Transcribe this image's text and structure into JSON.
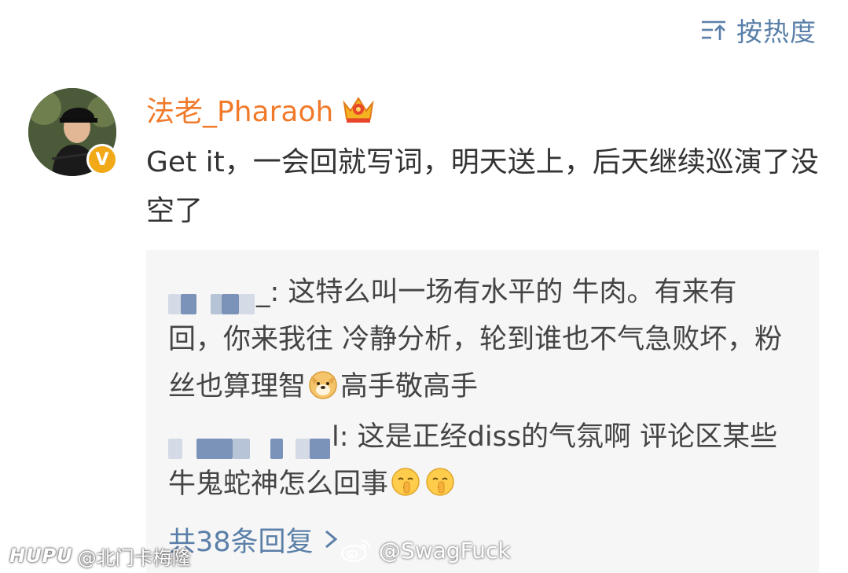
{
  "sort": {
    "label": "按热度",
    "icon": "sort-icon",
    "color": "#5a7fa8"
  },
  "comment": {
    "avatar_icon": "user-avatar",
    "badge_icon": "vip-v-badge",
    "username": "法老_Pharaoh",
    "username_color": "#f07a2a",
    "member_icon": "crown-icon",
    "text": "Get it，一会回就写词，明天送上，后天继续巡演了没空了"
  },
  "replies": {
    "items": [
      {
        "author_visible": "_",
        "author_blurred": true,
        "text_1": ": 这特么叫一场有水平的 牛肉。有来有回，你来我往 冷静分析，轮到谁也不气急败坏，粉丝也算理智",
        "emoji": "doge-emoji",
        "text_2": "高手敬高手"
      },
      {
        "author_visible": "",
        "author_blurred": true,
        "text_1": "l: 这是正经diss的气氛啊  评论区某些牛鬼蛇神怎么回事",
        "emojis": [
          "shush-emoji",
          "shush-emoji"
        ]
      }
    ],
    "more_label": "共38条回复",
    "more_icon": "chevron-right-icon"
  },
  "watermarks": {
    "left_logo": "HUPU",
    "left_text": "@北门卡梅隆",
    "right_icon": "weibo-logo-icon",
    "right_text": "@SwagFuck"
  }
}
